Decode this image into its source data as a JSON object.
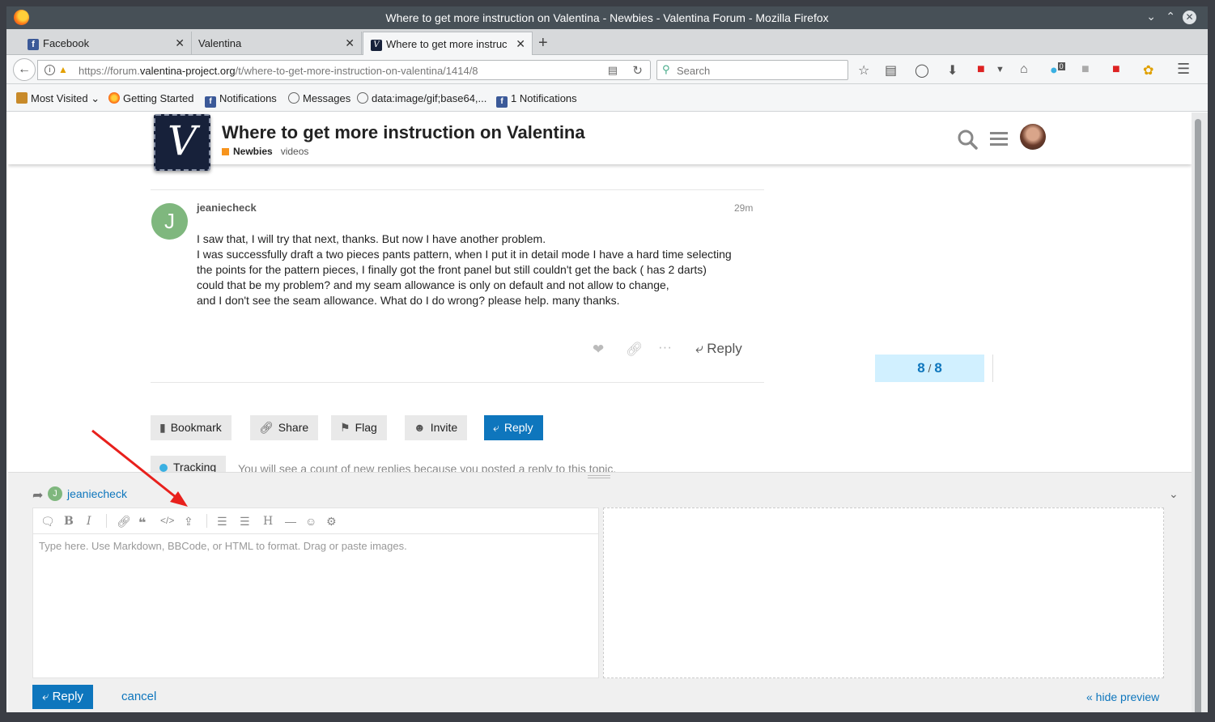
{
  "window": {
    "title": "Where to get more instruction on Valentina - Newbies - Valentina Forum - Mozilla Firefox"
  },
  "tabs": [
    {
      "label": "Facebook",
      "favicon": "f"
    },
    {
      "label": "Valentina",
      "favicon": ""
    },
    {
      "label": "Where to get more instruc",
      "favicon": "V"
    }
  ],
  "navbar": {
    "url_prefix": "https://forum.",
    "url_domain": "valentina-project.org",
    "url_path": "/t/where-to-get-more-instruction-on-valentina/1414/8",
    "search_placeholder": "Search",
    "notification_count": "0"
  },
  "bookmarks": [
    {
      "label": "Most Visited",
      "icon": "folder-icon"
    },
    {
      "label": "Getting Started",
      "icon": "firefox-icon"
    },
    {
      "label": "Notifications",
      "icon": "facebook-icon"
    },
    {
      "label": "Messages",
      "icon": "globe-icon"
    },
    {
      "label": "data:image/gif;base64,...",
      "icon": "globe-icon"
    },
    {
      "label": "1 Notifications",
      "icon": "facebook-icon"
    }
  ],
  "topic": {
    "title": "Where to get more instruction on Valentina",
    "category": "Newbies",
    "category_color": "#f7941d",
    "tag": "videos"
  },
  "post": {
    "avatar_letter": "J",
    "username": "jeaniecheck",
    "time": "29m",
    "lines": [
      "I saw that, I will try that next, thanks. But now I have another problem.",
      "I was successfully draft a two pieces pants pattern, when I put it in detail mode I have a hard time selecting",
      "the points for the pattern pieces, I finally got the front panel but still couldn't get the back ( has 2 darts)",
      "could that be my problem? and my seam allowance is only on default and not allow to change,",
      "and I don't see the seam allowance. What do I do wrong? please help. many thanks."
    ],
    "reply_label": "Reply"
  },
  "timeline": {
    "current": "8",
    "total": "8"
  },
  "footer_buttons": {
    "bookmark": "Bookmark",
    "share": "Share",
    "flag": "Flag",
    "invite": "Invite",
    "reply": "Reply"
  },
  "tracking": {
    "label": "Tracking",
    "description": "You will see a count of new replies because you posted a reply to this topic."
  },
  "composer": {
    "reply_to_letter": "J",
    "reply_to_user": "jeaniecheck",
    "placeholder": "Type here. Use Markdown, BBCode, or HTML to format. Drag or paste images.",
    "reply_label": "Reply",
    "cancel_label": "cancel",
    "hide_preview_label": "« hide preview"
  },
  "colors": {
    "primary": "#0e76bd",
    "timeline_bg": "#d1f0ff",
    "annotation_arrow": "#e8201c"
  }
}
